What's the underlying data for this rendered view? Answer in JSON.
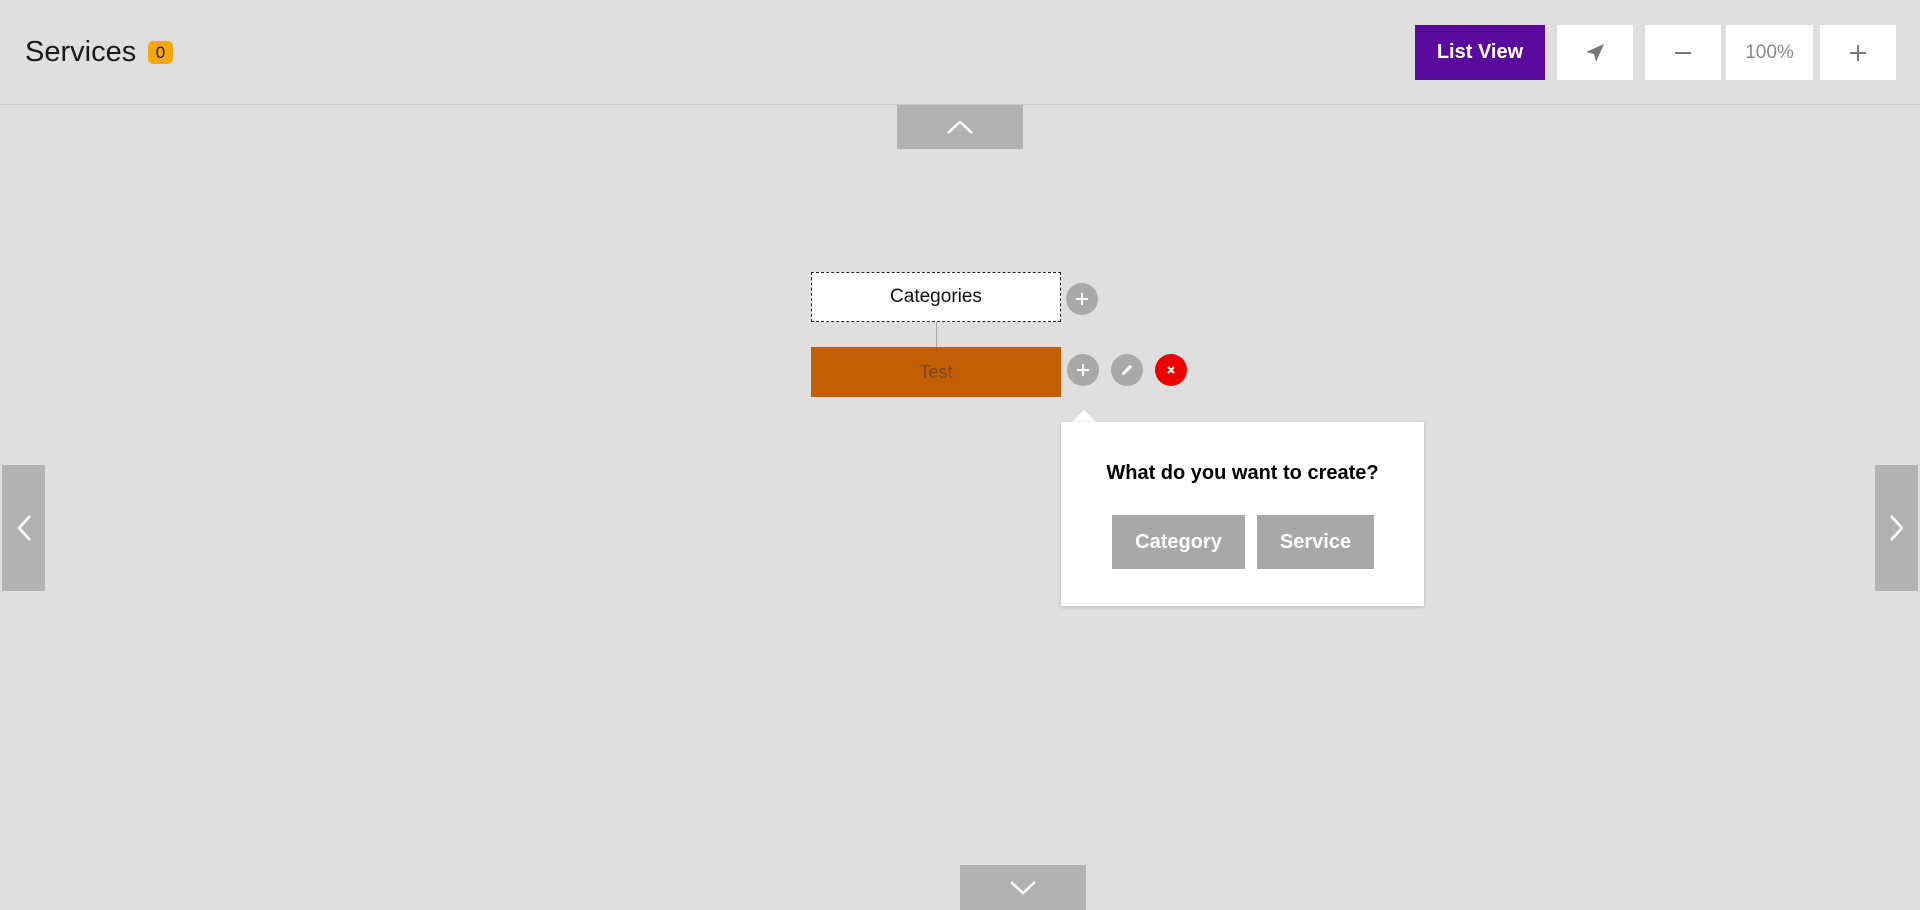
{
  "header": {
    "title": "Services",
    "badge_count": "0"
  },
  "toolbar": {
    "list_view_label": "List View",
    "locate_icon": "navigation-arrow-icon",
    "zoom_out_icon": "minus-icon",
    "zoom_level": "100%",
    "zoom_in_icon": "plus-icon",
    "accent_color": "#5b0a9e"
  },
  "navigation": {
    "up_icon": "chevron-up-icon",
    "down_icon": "chevron-down-icon",
    "left_icon": "chevron-left-icon",
    "right_icon": "chevron-right-icon"
  },
  "tree": {
    "root": {
      "label": "Categories"
    },
    "child": {
      "label": "Test",
      "color": "#c45e04"
    }
  },
  "popup": {
    "question": "What do you want to create?",
    "options": [
      {
        "label": "Category"
      },
      {
        "label": "Service"
      }
    ]
  },
  "colors": {
    "badge": "#f5a70f",
    "delete": "#ee0000"
  }
}
